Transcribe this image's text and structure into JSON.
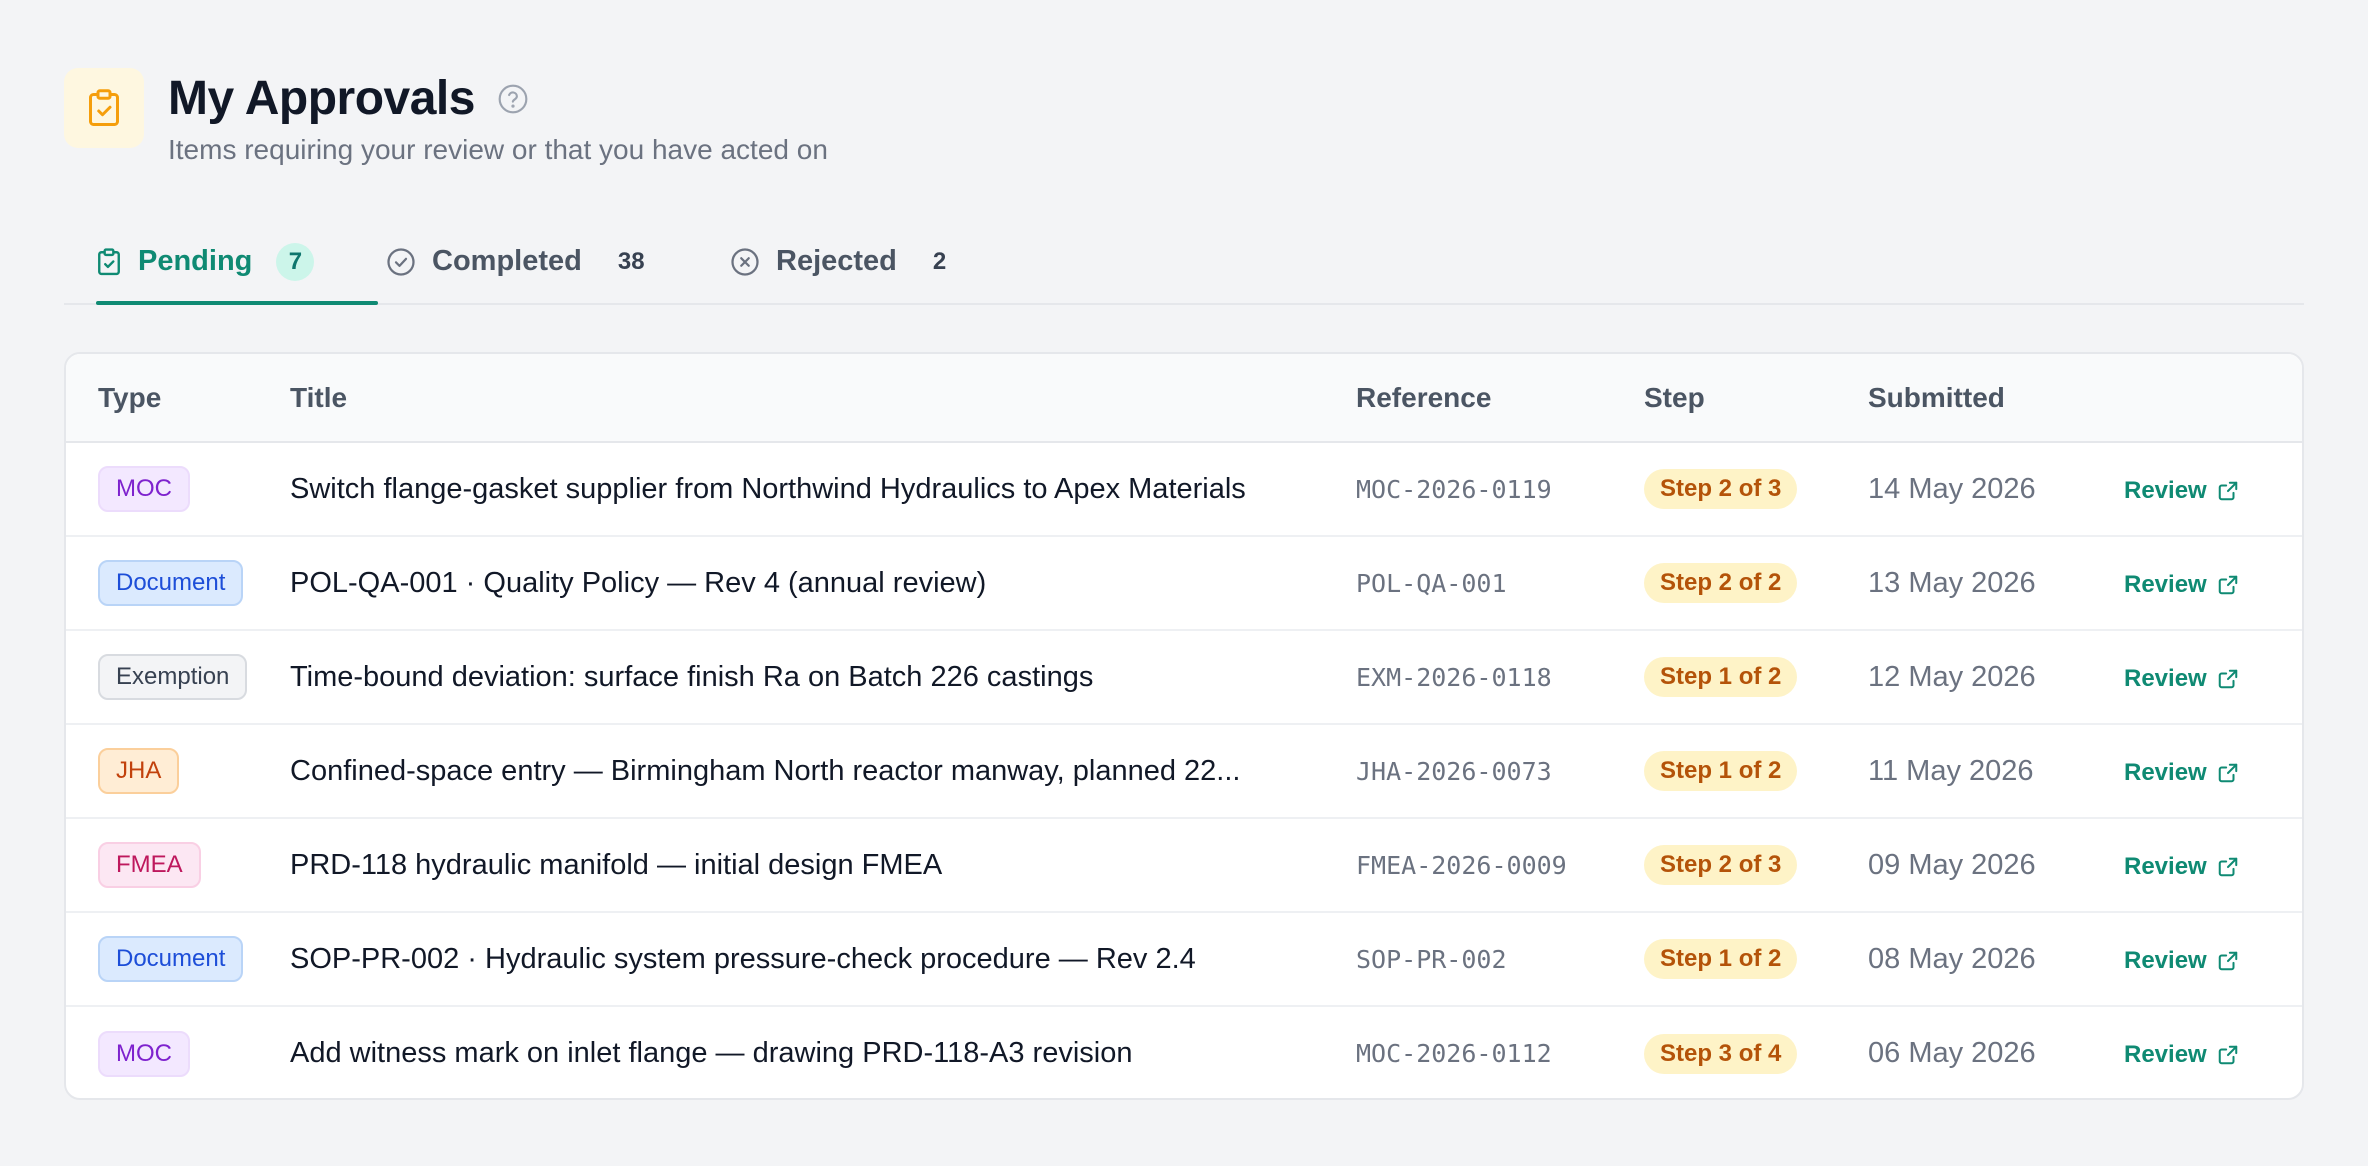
{
  "header": {
    "title": "My Approvals",
    "subtitle": "Items requiring your review or that you have acted on",
    "icon": "clipboard-check-icon",
    "help_icon": "help-circle-icon"
  },
  "tabs": [
    {
      "label": "Pending",
      "count": "7",
      "icon": "clipboard-check-icon",
      "active": true
    },
    {
      "label": "Completed",
      "count": "38",
      "icon": "check-circle-icon",
      "active": false
    },
    {
      "label": "Rejected",
      "count": "2",
      "icon": "x-circle-icon",
      "active": false
    }
  ],
  "table": {
    "columns": [
      "Type",
      "Title",
      "Reference",
      "Step",
      "Submitted"
    ],
    "rows": [
      {
        "type": "MOC",
        "title": "Switch flange-gasket supplier from Northwind Hydraulics to Apex Materials",
        "reference": "MOC-2026-0119",
        "step": "Step 2 of 3",
        "submitted": "14 May 2026",
        "action": "Review"
      },
      {
        "type": "Document",
        "title": "POL-QA-001 · Quality Policy — Rev 4 (annual review)",
        "reference": "POL-QA-001",
        "step": "Step 2 of 2",
        "submitted": "13 May 2026",
        "action": "Review"
      },
      {
        "type": "Exemption",
        "title": "Time-bound deviation: surface finish Ra on Batch 226 castings",
        "reference": "EXM-2026-0118",
        "step": "Step 1 of 2",
        "submitted": "12 May 2026",
        "action": "Review"
      },
      {
        "type": "JHA",
        "title": "Confined-space entry — Birmingham North reactor manway, planned 22...",
        "reference": "JHA-2026-0073",
        "step": "Step 1 of 2",
        "submitted": "11 May 2026",
        "action": "Review"
      },
      {
        "type": "FMEA",
        "title": "PRD-118 hydraulic manifold — initial design FMEA",
        "reference": "FMEA-2026-0009",
        "step": "Step 2 of 3",
        "submitted": "09 May 2026",
        "action": "Review"
      },
      {
        "type": "Document",
        "title": "SOP-PR-002 · Hydraulic system pressure-check procedure — Rev 2.4",
        "reference": "SOP-PR-002",
        "step": "Step 1 of 2",
        "submitted": "08 May 2026",
        "action": "Review"
      },
      {
        "type": "MOC",
        "title": "Add witness mark on inlet flange — drawing PRD-118-A3 revision",
        "reference": "MOC-2026-0112",
        "step": "Step 3 of 4",
        "submitted": "06 May 2026",
        "action": "Review"
      }
    ]
  },
  "colors": {
    "accent": "#0f8a73",
    "header_icon": "#f59e0b",
    "step_badge_bg": "#fef3c7",
    "step_badge_text": "#b45309"
  }
}
